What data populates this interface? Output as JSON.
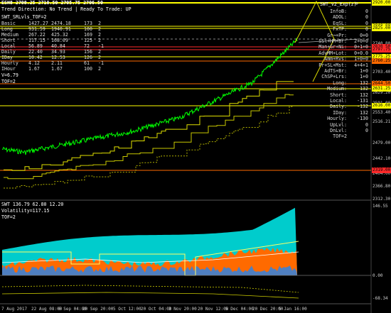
{
  "main": {
    "symbol_line": "ESH8  2708.25 2710.50 2705.75 2706.50",
    "direction_line": "Trend Direction:  No Trend  |  Ready To Trade:  UP",
    "title_label": "SWT_SRLvls_TOF=2",
    "levels": [
      [
        "Basic",
        "1427.27",
        "2474.18",
        "173",
        "2"
      ],
      [
        "Long",
        "931.59",
        "1940.91",
        "100",
        "2"
      ],
      [
        "Medium",
        "267.22",
        "425.32",
        "169",
        "2"
      ],
      [
        "Short",
        "117.15",
        "168.09",
        "125",
        "2"
      ],
      [
        "Local",
        "56.89",
        "40.84",
        "72",
        "-1"
      ],
      [
        "Daily",
        "22.40",
        "34.93",
        "156",
        "2"
      ],
      [
        "IDay",
        "10.42",
        "12.53",
        "126",
        "2"
      ],
      [
        "Hourly",
        "4.12",
        "2.11",
        "61",
        "-1"
      ],
      [
        "IHour",
        "1.67",
        "1.67",
        "100",
        "2"
      ]
    ],
    "v_line": "V=6.79",
    "tof_line": "TOF=2",
    "right_panel": [
      [
        "InfoB:",
        "0"
      ],
      [
        "ADOL:",
        "0"
      ],
      [
        "EqSL:",
        "0"
      ],
      [
        "FxTP:",
        "0"
      ],
      [
        "Gr¬+Pr:",
        "0+0"
      ],
      [
        "SSl+HM+Br:",
        "2+0+0"
      ],
      [
        "Man+Gr+Ni:",
        "0+1+0"
      ],
      [
        "AdvMM+Lot:",
        "0+0.0"
      ],
      [
        "Amm+Rvs:",
        "1+0+0"
      ],
      [
        "Pr+SL+Mst:",
        "4+4+1"
      ],
      [
        "AdTS+Br:",
        "1+0"
      ],
      [
        "ChSP+Lrs:",
        "1+0"
      ],
      [
        "Long:",
        "132"
      ],
      [
        "Medium:",
        "132"
      ],
      [
        "Short:",
        "132"
      ],
      [
        "Local:",
        "-131"
      ],
      [
        "Daily:",
        "-132"
      ],
      [
        "IDay:",
        "132"
      ],
      [
        "Hourly:",
        "-130"
      ],
      [
        "UpLvl:",
        "0"
      ],
      [
        "DnLvl:",
        "0"
      ],
      [
        "TOF=2",
        ""
      ]
    ],
    "top_right_label": "SWT_v2_Exp(z)",
    "price_axis": [
      "2823.00",
      "2781.21",
      "2740.80",
      "2703.40",
      "2666.40",
      "2629.20",
      "2591.00",
      "2553.40",
      "2516.21",
      "2479.00",
      "2442.10",
      "2404.00",
      "2366.80",
      "2312.30"
    ],
    "price_tags": [
      {
        "text": "2920.00",
        "bg": "#ffff00",
        "fg": "#000000"
      },
      {
        "text": "2848.00",
        "bg": "#ffff00",
        "fg": "#000000"
      },
      {
        "text": "2825.00",
        "bg": "#ffff00",
        "fg": "#000000"
      },
      {
        "text": "2810.50",
        "bg": "#ff2a2a",
        "fg": "#000000"
      },
      {
        "text": "2797.75",
        "bg": "#ff2a2a",
        "fg": "#000000"
      },
      {
        "text": "2775.25",
        "bg": "#ffff00",
        "fg": "#000000"
      },
      {
        "text": "2760.25",
        "bg": "#ff6a00",
        "fg": "#000000"
      },
      {
        "text": "2644.50",
        "bg": "#ff6a00",
        "fg": "#000000"
      },
      {
        "text": "2631.25",
        "bg": "#ffff00",
        "fg": "#000000"
      },
      {
        "text": "2616.00",
        "bg": "#ffff00",
        "fg": "#000000"
      },
      {
        "text": "2319.00",
        "bg": "#ff2a2a",
        "fg": "#000000"
      }
    ]
  },
  "sub": {
    "label1": "SWT 136.79 62.80 12.20",
    "label2": "Volatility=117.15",
    "label3": "TOF=2",
    "axis": [
      "146.55",
      "0.00",
      "-68.34"
    ]
  },
  "xaxis": [
    "7 Aug 2017",
    "22 Aug 08:00",
    "6 Sep 04:00",
    "20 Sep 20:00",
    "5 Oct 12:00",
    "20 Oct 04:00",
    "3 Nov 20:00",
    "20 Nov 12:00",
    "5 Dec 04:00",
    "20 Dec 20:00",
    "5 Jan 16:00"
  ],
  "colors": {
    "price": "#00ff00",
    "level_yellow": "#ffff00",
    "level_red": "#ff2a2a",
    "cyan": "#00cccc",
    "orange": "#ff6a00",
    "blue": "#4f7fc0"
  }
}
